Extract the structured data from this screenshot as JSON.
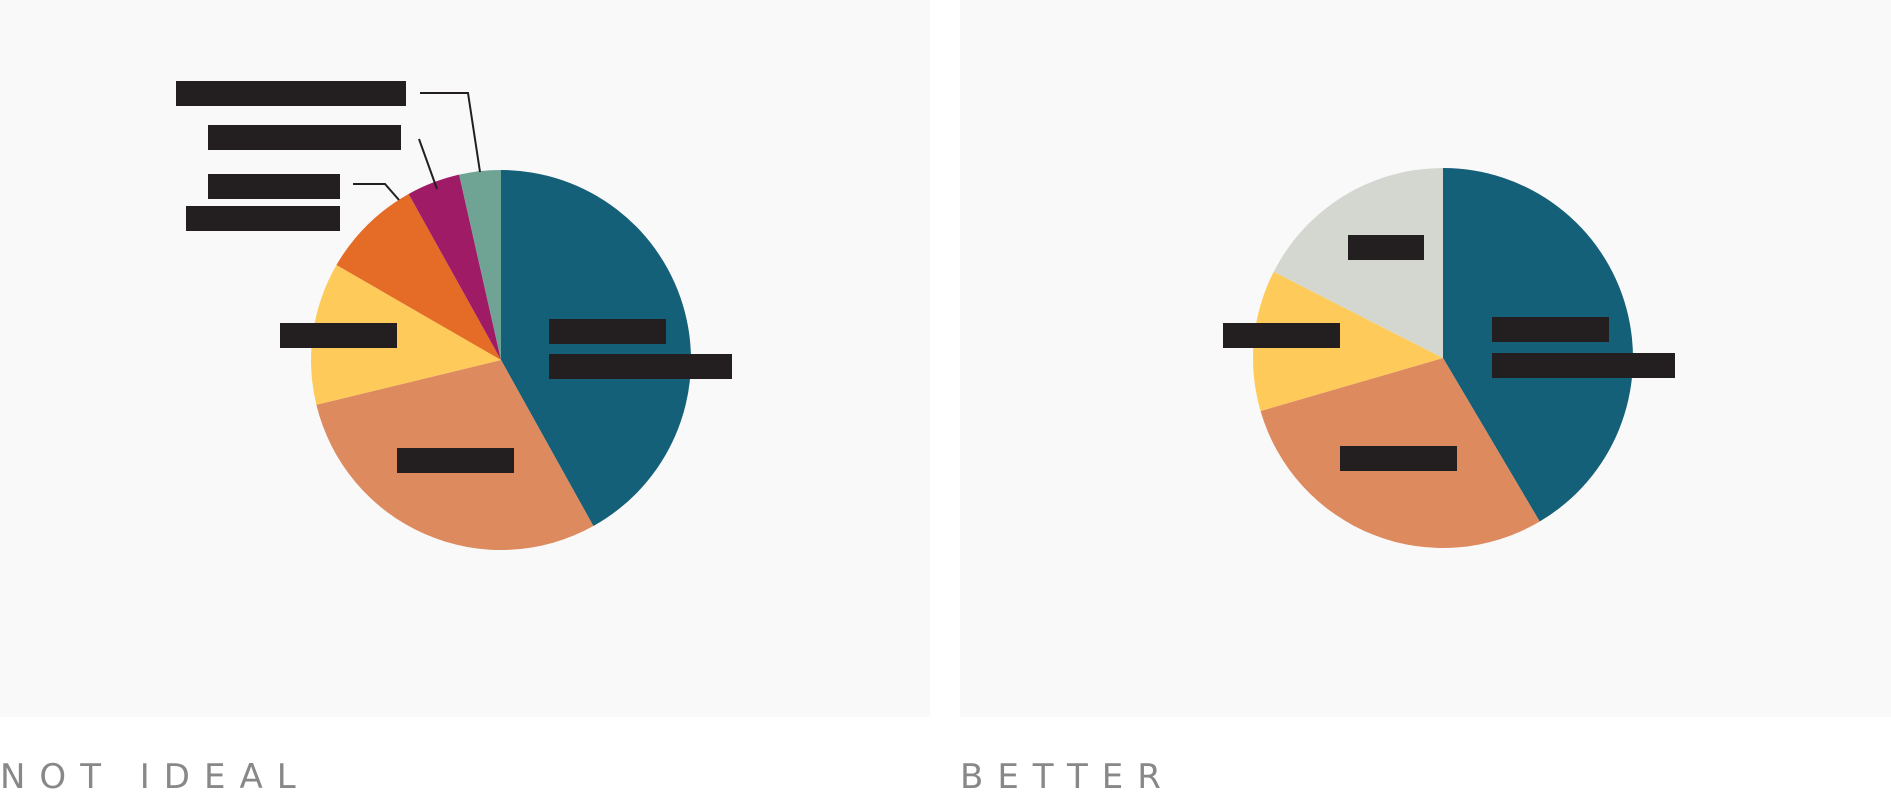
{
  "captions": {
    "left": "NOT IDEAL",
    "right": "BETTER"
  },
  "colors": {
    "panel_background": "#f9f9f9",
    "label_bar": "#231f20",
    "leader_line": "#231f20",
    "caption": "#888888"
  },
  "chart_data": [
    {
      "type": "pie",
      "title": "",
      "start_angle_deg": 0,
      "direction": "clockwise",
      "labels_redacted": true,
      "slices": [
        {
          "value": 41.5,
          "color": "#156079"
        },
        {
          "value": 29.0,
          "color": "#de8a5f"
        },
        {
          "value": 12.0,
          "color": "#fecb5b"
        },
        {
          "value": 8.5,
          "color": "#e46c27"
        },
        {
          "value": 4.5,
          "color": "#a01b66"
        },
        {
          "value": 3.5,
          "color": "#6fa495"
        }
      ]
    },
    {
      "type": "pie",
      "title": "",
      "start_angle_deg": 0,
      "direction": "clockwise",
      "labels_redacted": true,
      "slices": [
        {
          "value": 41.5,
          "color": "#156079"
        },
        {
          "value": 29.0,
          "color": "#de8a5f"
        },
        {
          "value": 12.0,
          "color": "#fecb5b"
        },
        {
          "value": 17.5,
          "color": "#d3d7d0"
        }
      ]
    }
  ]
}
